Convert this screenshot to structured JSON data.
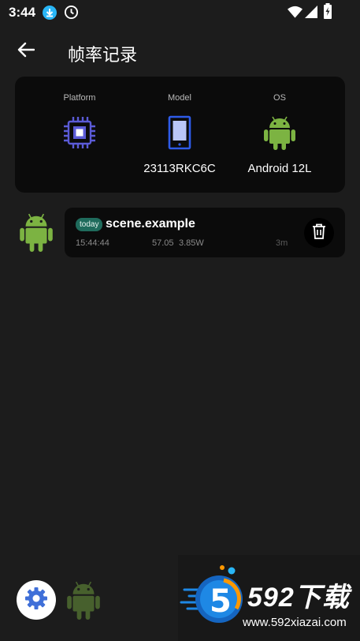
{
  "status_bar": {
    "time": "3:44",
    "icons": [
      "download-icon",
      "clock-icon",
      "wifi-icon",
      "signal-icon",
      "battery-icon"
    ]
  },
  "app_bar": {
    "back_icon": "arrow-left-icon",
    "title": "帧率记录"
  },
  "device_info": {
    "platform": {
      "label": "Platform",
      "icon": "chip-icon",
      "value": ""
    },
    "model": {
      "label": "Model",
      "icon": "phone-icon",
      "value": "23113RKC6C"
    },
    "os": {
      "label": "OS",
      "icon": "android-icon",
      "value": "Android 12L"
    }
  },
  "records": [
    {
      "app_icon": "android-icon",
      "badge": "today",
      "name": "scene.example",
      "time": "15:44:44",
      "fps": "57.05",
      "power": "3.85W",
      "duration": "3m",
      "delete_icon": "trash-icon"
    }
  ],
  "bottom": {
    "settings_icon": "gear-icon",
    "app_icon": "android-icon"
  },
  "watermark": {
    "brand": "592下载",
    "url": "www.592xiazai.com"
  },
  "colors": {
    "background": "#1c1c1c",
    "card": "#0b0b0b",
    "android_green": "#7cb342",
    "chip_purple": "#5b5bd6",
    "phone_blue": "#2e5be8",
    "badge_teal": "#1f6b5c"
  }
}
